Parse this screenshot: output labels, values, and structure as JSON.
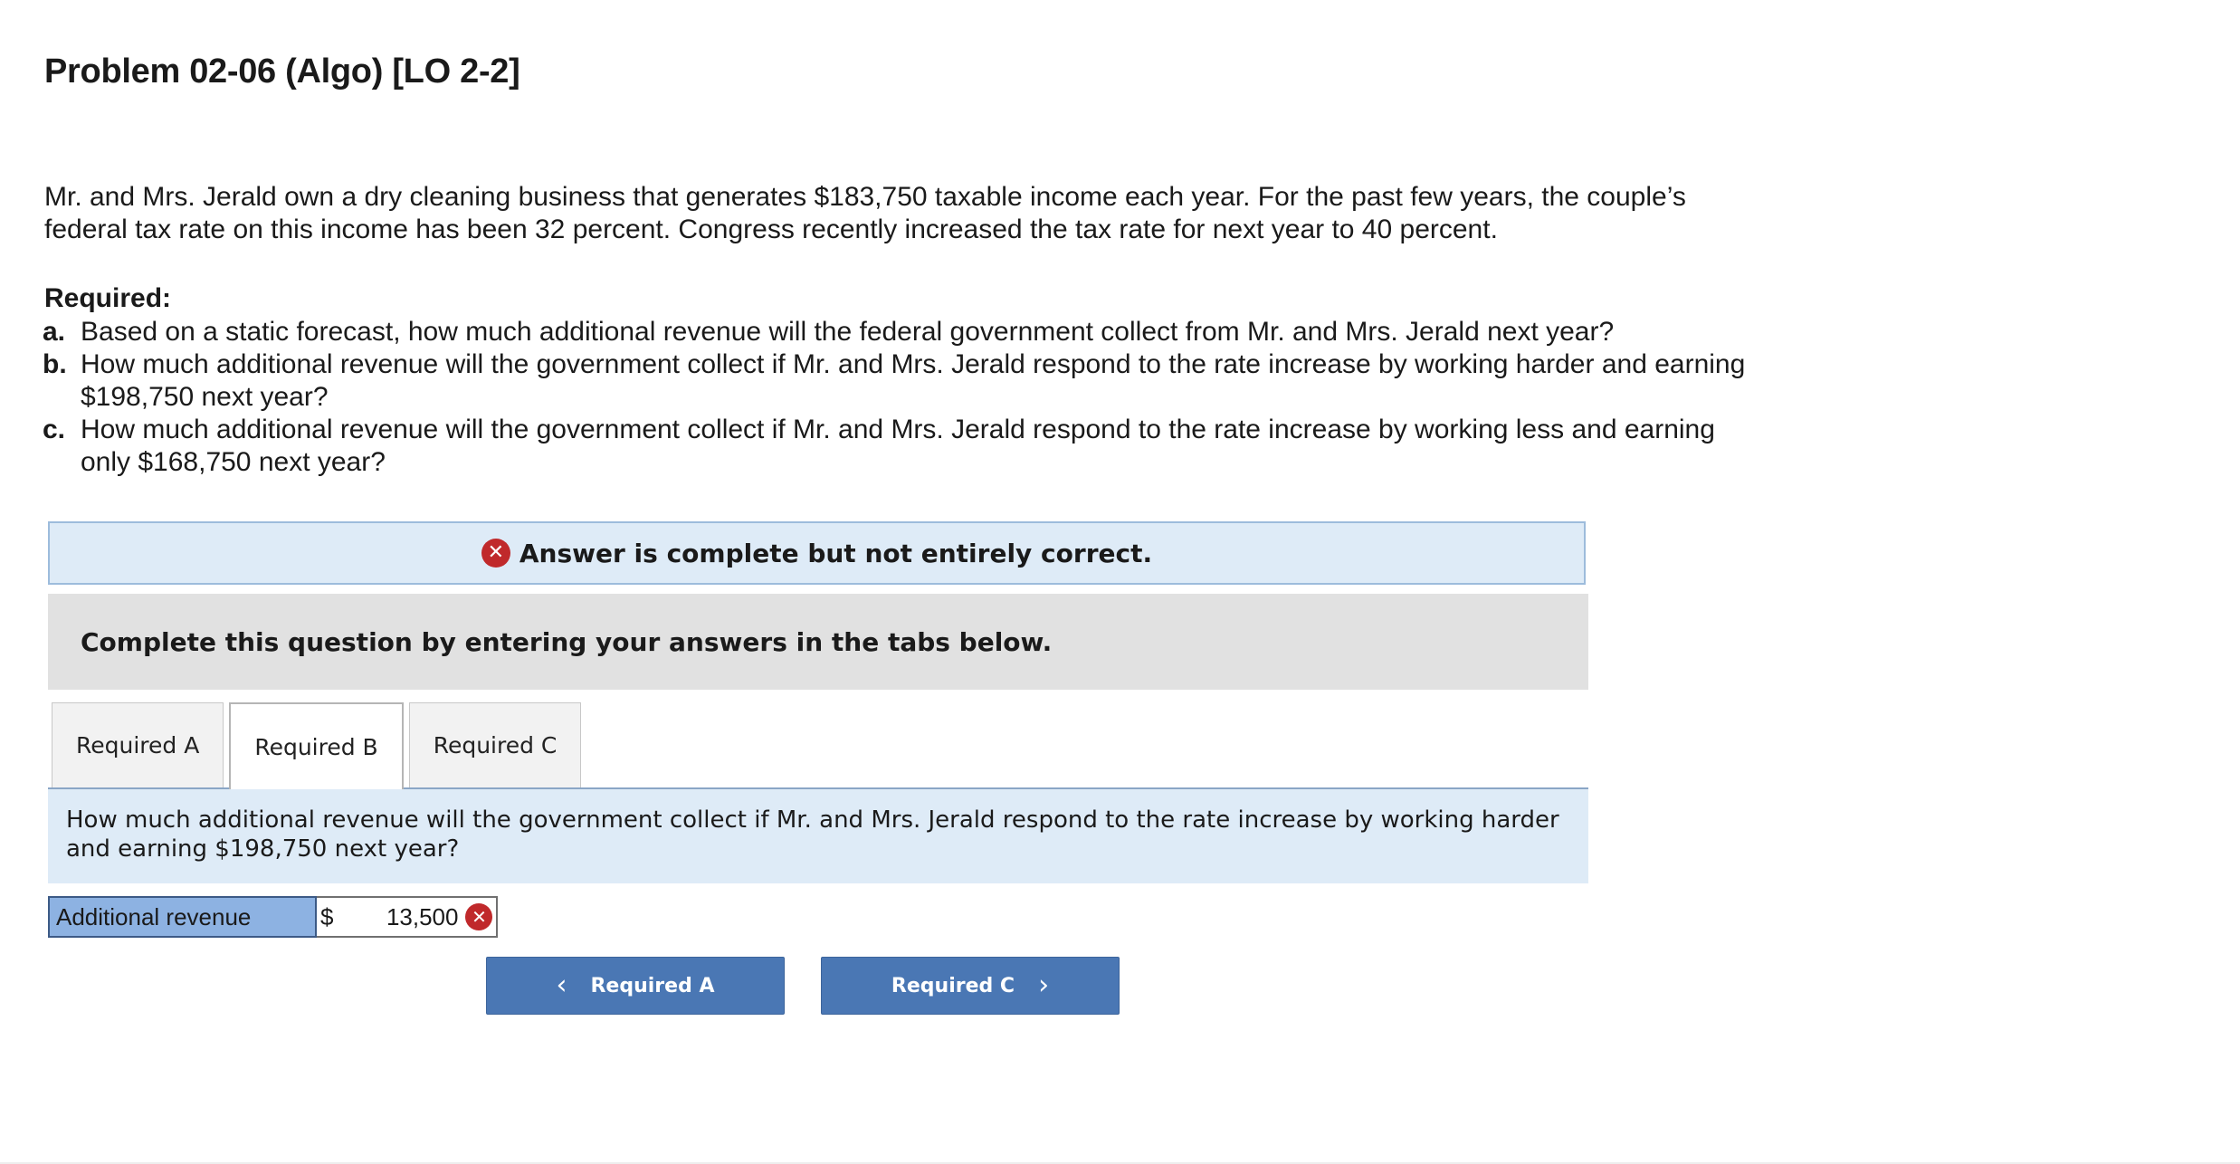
{
  "problem": {
    "title": "Problem 02-06 (Algo) [LO 2-2]",
    "intro": "Mr. and Mrs. Jerald own a dry cleaning business that generates $183,750 taxable income each year. For the past few years, the couple’s federal tax rate on this income has been 32 percent. Congress recently increased the tax rate for next year to 40 percent.",
    "required_heading": "Required:",
    "requirements": [
      {
        "letter": "a.",
        "text": "Based on a static forecast, how much additional revenue will the federal government collect from Mr. and Mrs. Jerald next year?"
      },
      {
        "letter": "b.",
        "text": "How much additional revenue will the government collect if Mr. and Mrs. Jerald respond to the rate increase by working harder and earning $198,750 next year?"
      },
      {
        "letter": "c.",
        "text": "How much additional revenue will the government collect if Mr. and Mrs. Jerald respond to the rate increase by working less and earning only $168,750 next year?"
      }
    ]
  },
  "alert": {
    "text": "Answer is complete but not entirely correct.",
    "icon": "x-circle-icon",
    "color": "#c0292b"
  },
  "instructions": "Complete this question by entering your answers in the tabs below.",
  "tabs": [
    {
      "label": "Required A",
      "active": false
    },
    {
      "label": "Required B",
      "active": true
    },
    {
      "label": "Required C",
      "active": false
    }
  ],
  "panel": {
    "question": "How much additional revenue will the government collect if Mr. and Mrs. Jerald respond to the rate increase by working harder and earning $198,750 next year?",
    "answer_label": "Additional revenue",
    "currency": "$",
    "answer_value": "13,500",
    "answer_status": "incorrect"
  },
  "navigation": {
    "prev_label": "Required A",
    "next_label": "Required C",
    "button_color": "#4a77b4"
  }
}
